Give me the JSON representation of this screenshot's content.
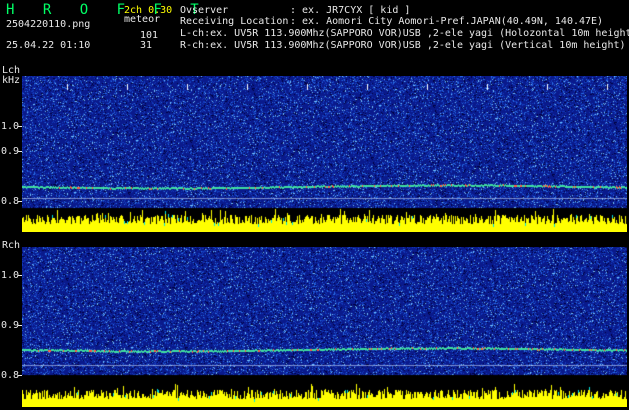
{
  "header": {
    "logo": "H R O F F T",
    "mode": "2ch 0.30",
    "filename": "2504220110.png",
    "meteor_label": "meteor",
    "datetime": "25.04.22 01:10",
    "count_l": "101",
    "count_r": "31",
    "observer_label": "Ovserver",
    "observer_value": ": ex. JR7CYX [ kid ]",
    "location_label": "Receiving Location",
    "location_value": ": ex. Aomori City Aomori-Pref.JAPAN(40.49N, 140.47E)",
    "lch_info": "L-ch:ex. UV5R 113.900Mhz(SAPPORO VOR)USB ,2-ele yagi (Holozontal 10m height)",
    "rch_info": "R-ch:ex. UV5R 113.900Mhz(SAPPORO VOR)USB ,2-ele yagi (Vertical 10m height)"
  },
  "panels": {
    "lch": {
      "label": "Lch",
      "unit": "kHz",
      "y_ticks": [
        "1.0",
        "0.9",
        "0.8"
      ]
    },
    "rch": {
      "label": "Rch",
      "y_ticks": [
        "1.0",
        "0.9",
        "0.8"
      ]
    }
  },
  "time_ticks": [
    "0111",
    "0112",
    "0113",
    "0114",
    "0115",
    "0116",
    "0117",
    "0118",
    "0119",
    "0120"
  ],
  "colors": {
    "background": "#000000",
    "spectrogram_bg": "#0a1a8c",
    "text_cyan": "#00e5e5",
    "text_green": "#00ff66",
    "text_yellow": "#ffff00",
    "signal_bar": "#ffff00",
    "signal_bar_accent": "#00e5e5"
  }
}
